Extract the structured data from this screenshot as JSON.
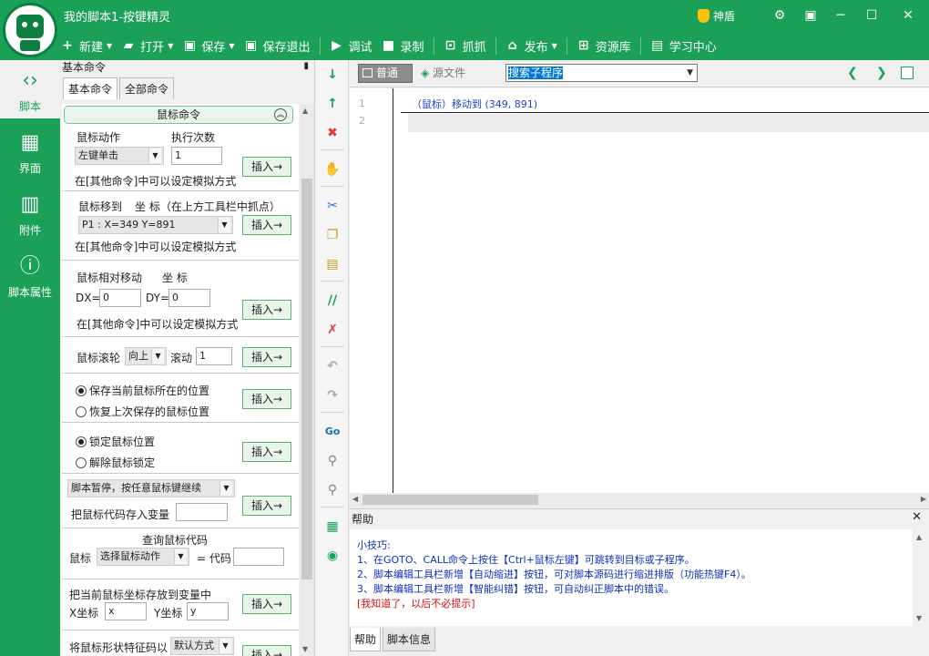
{
  "app": {
    "title": "我的脚本1-按键精灵",
    "shield_label": "神盾"
  },
  "toolbar": [
    {
      "label": "新建",
      "icon": "plus-icon",
      "dropdown": true
    },
    {
      "label": "打开",
      "icon": "folder-icon",
      "dropdown": true
    },
    {
      "label": "保存",
      "icon": "save-icon",
      "dropdown": true
    },
    {
      "label": "保存退出",
      "icon": "save-exit-icon",
      "dropdown": false
    },
    {
      "label": "调试",
      "icon": "play-icon",
      "dropdown": false
    },
    {
      "label": "录制",
      "icon": "camera-icon",
      "dropdown": false
    },
    {
      "label": "抓抓",
      "icon": "capture-icon",
      "dropdown": false
    },
    {
      "label": "发布",
      "icon": "publish-icon",
      "dropdown": true
    },
    {
      "label": "资源库",
      "icon": "resource-icon",
      "dropdown": false
    },
    {
      "label": "学习中心",
      "icon": "learn-icon",
      "dropdown": false
    }
  ],
  "leftnav": [
    {
      "label": "脚本",
      "icon": "script-icon",
      "active": true
    },
    {
      "label": "界面",
      "icon": "interface-icon",
      "active": false
    },
    {
      "label": "附件",
      "icon": "attachment-icon",
      "active": false
    },
    {
      "label": "脚本属性",
      "icon": "info-icon",
      "active": false
    }
  ],
  "panel": {
    "title": "基本命令",
    "tabs": [
      "基本命令",
      "全部命令"
    ],
    "section_header": "鼠标命令",
    "insert_label": "插入→",
    "mouse_action": {
      "label": "鼠标动作",
      "count_label": "执行次数",
      "action_value": "左键单击",
      "count_value": "1",
      "hint": "在[其他命令]中可以设定模拟方式"
    },
    "mouse_move": {
      "label": "鼠标移到",
      "coord_label": "坐 标（在上方工具栏中抓点）",
      "point_value": "P1 : X=349 Y=891",
      "hint": "在[其他命令]中可以设定模拟方式"
    },
    "mouse_rel": {
      "label": "鼠标相对移动",
      "coord_label": "坐 标",
      "dx_label": "DX=",
      "dx_value": "0",
      "dy_label": "DY=",
      "dy_value": "0",
      "hint": "在[其他命令]中可以设定模拟方式"
    },
    "wheel": {
      "label": "鼠标滚轮",
      "direction": "向上",
      "scroll_label": "滚动",
      "scroll_value": "1"
    },
    "save_pos": {
      "opt1": "保存当前鼠标所在的位置",
      "opt2": "恢复上次保存的鼠标位置"
    },
    "lock": {
      "opt1": "锁定鼠标位置",
      "opt2": "解除鼠标锁定"
    },
    "pause": {
      "select": "脚本暂停，按任意鼠标键继续",
      "store_label": "把鼠标代码存入变量"
    },
    "query": {
      "title": "查询鼠标代码",
      "label": "鼠标",
      "select": "选择鼠标动作",
      "eq_label": "= 代码"
    },
    "store_coord": {
      "title": "把当前鼠标坐标存放到变量中",
      "x_label": "X坐标",
      "x_value": "x",
      "y_label": "Y坐标",
      "y_value": "y"
    },
    "shape": {
      "title": "将鼠标形状特征码以",
      "select": "默认方式"
    }
  },
  "editor": {
    "mode_normal": "普通",
    "mode_source": "源文件",
    "sub_search": "搜索子程序",
    "line_numbers": [
      "1",
      "2"
    ],
    "code_line1": "（鼠标）移动到 (349, 891)"
  },
  "help": {
    "title": "帮助",
    "tip_title": "小技巧:",
    "tips": [
      "1、在GOTO、CALL命令上按住【Ctrl+鼠标左键】可跳转到目标或子程序。",
      "2、脚本编辑工具栏新增【自动缩进】按钮，可对脚本源码进行缩进排版（功能热键F4）。",
      "3、脚本编辑工具栏新增【智能纠错】按钮，可自动纠正脚本中的错误。"
    ],
    "dismiss": "[我知道了，以后不必提示]",
    "tabs": [
      "帮助",
      "脚本信息"
    ]
  },
  "colors": {
    "brand_green": "#1aa157",
    "code_blue": "#2040d0",
    "tip_red": "#d81010"
  }
}
